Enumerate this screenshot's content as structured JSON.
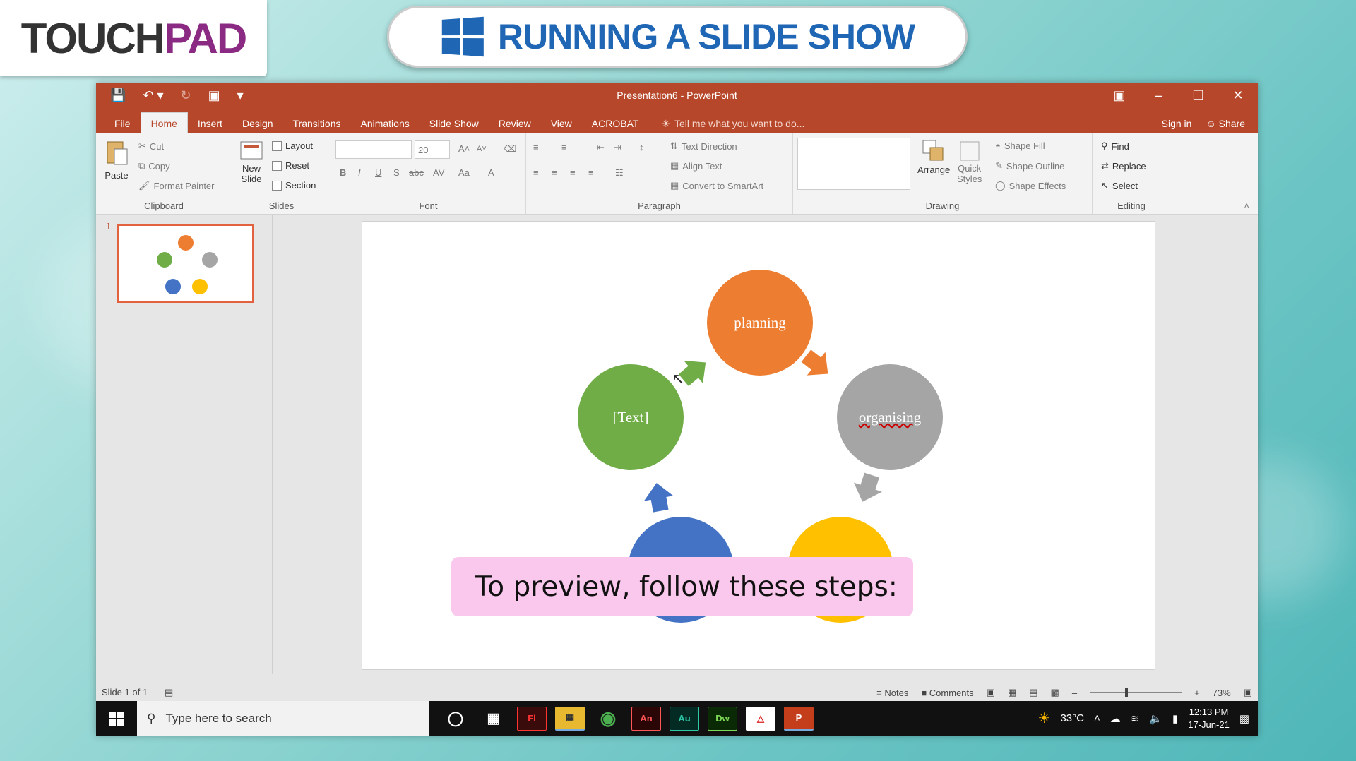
{
  "logo": {
    "part1": "TOUCH",
    "part2": "PAD"
  },
  "banner": {
    "title": "RUNNING A SLIDE SHOW"
  },
  "window": {
    "title": "Presentation6 - PowerPoint"
  },
  "tabs": [
    "File",
    "Home",
    "Insert",
    "Design",
    "Transitions",
    "Animations",
    "Slide Show",
    "Review",
    "View",
    "ACROBAT"
  ],
  "active_tab": "Home",
  "tell_me": "Tell me what you want to do...",
  "sign_in": "Sign in",
  "share": "Share",
  "ribbon": {
    "clipboard": {
      "paste": "Paste",
      "cut": "Cut",
      "copy": "Copy",
      "format_painter": "Format Painter",
      "label": "Clipboard"
    },
    "slides": {
      "new_slide_1": "New",
      "new_slide_2": "Slide",
      "layout": "Layout",
      "reset": "Reset",
      "section": "Section",
      "label": "Slides"
    },
    "font": {
      "size": "20",
      "label": "Font"
    },
    "paragraph": {
      "text_direction": "Text Direction",
      "align_text": "Align Text",
      "convert": "Convert to SmartArt",
      "label": "Paragraph"
    },
    "drawing": {
      "arrange": "Arrange",
      "quick_1": "Quick",
      "quick_2": "Styles",
      "shape_fill": "Shape Fill",
      "shape_outline": "Shape Outline",
      "shape_effects": "Shape Effects",
      "label": "Drawing"
    },
    "editing": {
      "find": "Find",
      "replace": "Replace",
      "select": "Select",
      "label": "Editing"
    }
  },
  "thumb": {
    "number": "1"
  },
  "slide": {
    "nodes": [
      {
        "label": "planning",
        "color": "#ed7d31"
      },
      {
        "label": "organising",
        "color": "#a5a5a5"
      },
      {
        "label": "",
        "color": "#ffc000"
      },
      {
        "label": "",
        "color": "#4472c4"
      },
      {
        "label": "[Text]",
        "color": "#70ad47"
      }
    ]
  },
  "caption": "To preview, follow these steps:",
  "status": {
    "slide": "Slide 1 of 1",
    "notes": "Notes",
    "comments": "Comments",
    "zoom": "73%"
  },
  "taskbar": {
    "search": "Type here to search",
    "temp": "33°C",
    "time": "12:13 PM",
    "date": "17-Jun-21"
  }
}
